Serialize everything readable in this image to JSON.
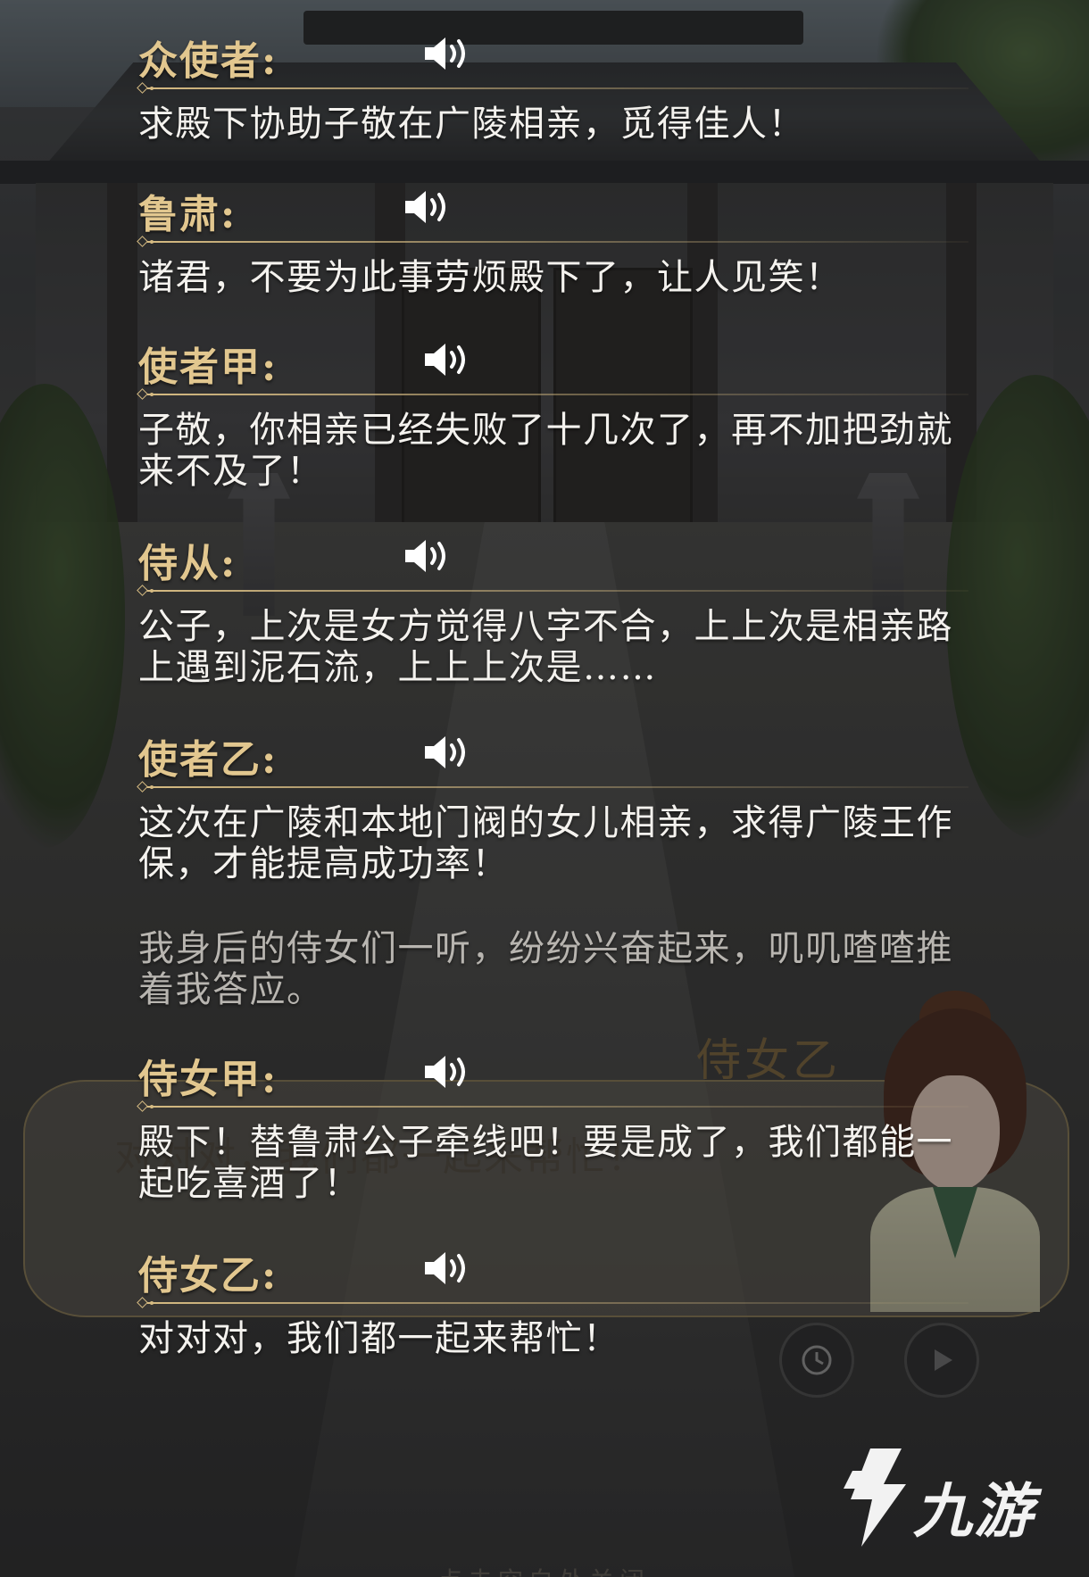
{
  "log_entries": [
    {
      "speaker": "众使者:",
      "text": "求殿下协助子敬在广陵相亲，觅得佳人！"
    },
    {
      "speaker": "鲁肃:",
      "text": "诸君，不要为此事劳烦殿下了，让人见笑！"
    },
    {
      "speaker": "使者甲:",
      "text": "子敬，你相亲已经失败了十几次了，再不加把劲就来不及了！"
    },
    {
      "speaker": "侍从:",
      "text": "公子，上次是女方觉得八字不合，上上次是相亲路上遇到泥石流，上上上次是……"
    },
    {
      "speaker": "使者乙:",
      "text": "这次在广陵和本地门阀的女儿相亲，求得广陵王作保，才能提高成功率！"
    },
    {
      "speaker": "侍女甲:",
      "text": "殿下！替鲁肃公子牵线吧！要是成了，我们都能一起吃喜酒了！"
    },
    {
      "speaker": "侍女乙:",
      "text": "对对对，我们都一起来帮忙！"
    }
  ],
  "narration": "我身后的侍女们一听，纷纷兴奋起来，叽叽喳喳推着我答应。",
  "background_dialog": {
    "speaker": "侍女乙",
    "text": "对对对，我们都一起来帮忙！"
  },
  "bottom_hint": "点击空白处关闭",
  "watermark": {
    "text": "九游"
  },
  "icons": {
    "voice": "speaker-volume-icon",
    "history": "history-clock-icon",
    "auto_play": "play-icon"
  },
  "colors": {
    "speaker": "#e2c78f",
    "dialogue": "#f4f2ee",
    "narration": "#b8b5b0",
    "divider": "#d6bb82"
  }
}
